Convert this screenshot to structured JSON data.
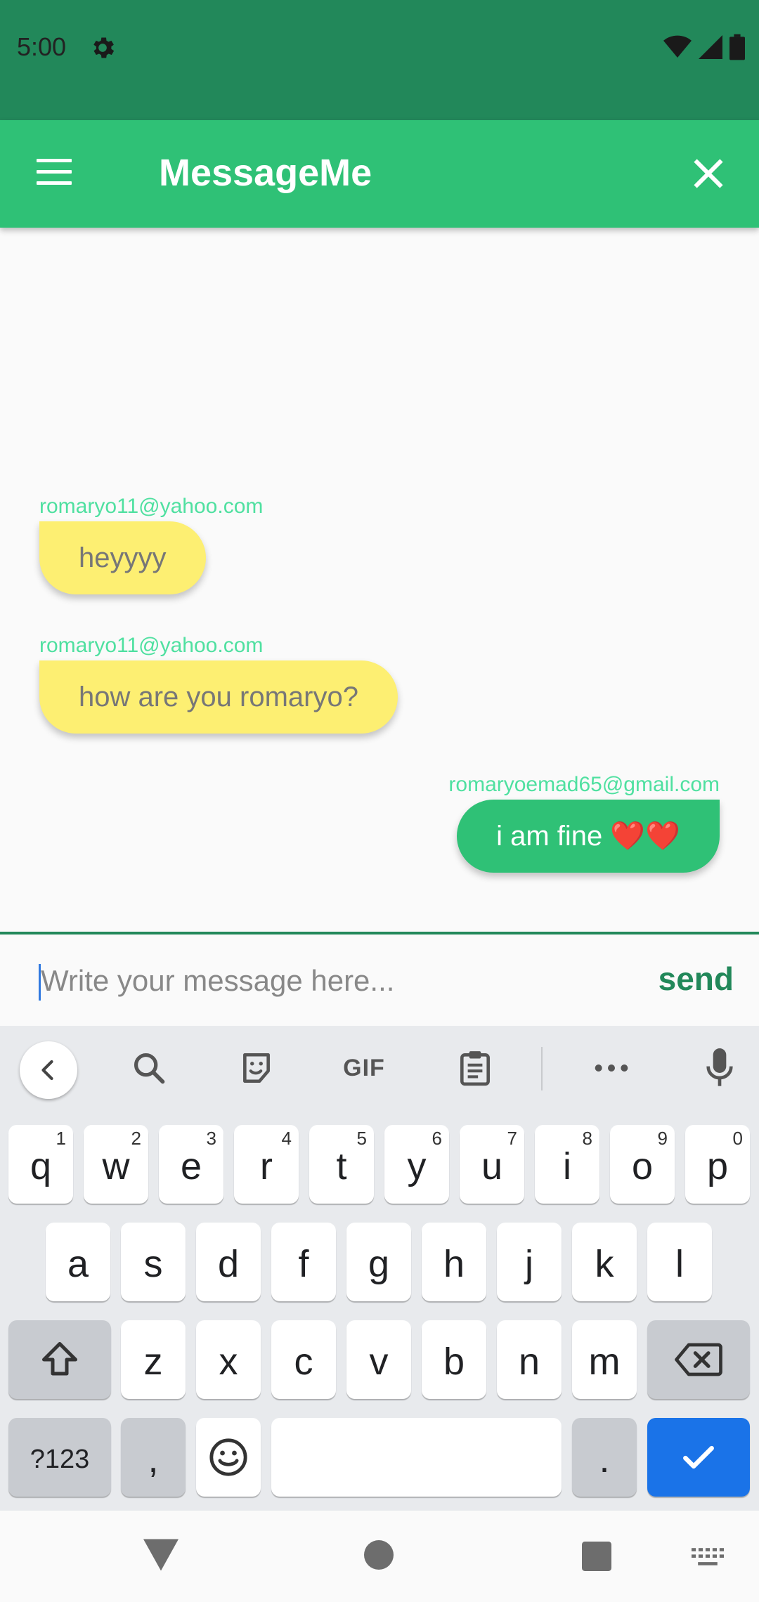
{
  "status_bar": {
    "time": "5:00"
  },
  "app_bar": {
    "title": "MessageMe"
  },
  "messages": [
    {
      "sender": "romaryo11@yahoo.com",
      "text": "heyyyy",
      "direction": "incoming"
    },
    {
      "sender": "romaryo11@yahoo.com",
      "text": "how are you romaryo?",
      "direction": "incoming"
    },
    {
      "sender": "romaryoemad65@gmail.com",
      "text": "i am fine ❤️❤️",
      "direction": "outgoing"
    }
  ],
  "composer": {
    "placeholder": "Write your message here...",
    "send_label": "send"
  },
  "keyboard": {
    "toolbar": {
      "gif_label": "GIF"
    },
    "row1": [
      {
        "key": "q",
        "hint": "1"
      },
      {
        "key": "w",
        "hint": "2"
      },
      {
        "key": "e",
        "hint": "3"
      },
      {
        "key": "r",
        "hint": "4"
      },
      {
        "key": "t",
        "hint": "5"
      },
      {
        "key": "y",
        "hint": "6"
      },
      {
        "key": "u",
        "hint": "7"
      },
      {
        "key": "i",
        "hint": "8"
      },
      {
        "key": "o",
        "hint": "9"
      },
      {
        "key": "p",
        "hint": "0"
      }
    ],
    "row2": [
      "a",
      "s",
      "d",
      "f",
      "g",
      "h",
      "j",
      "k",
      "l"
    ],
    "row3": [
      "z",
      "x",
      "c",
      "v",
      "b",
      "n",
      "m"
    ],
    "symbols_label": "?123",
    "comma_label": ",",
    "period_label": "."
  },
  "colors": {
    "status_bar": "#22885a",
    "app_bar": "#2fc176",
    "incoming_bubble": "#fdef72",
    "outgoing_bubble": "#2fc176",
    "sender_text": "#4fe0a0",
    "enter_key": "#1a73e8"
  }
}
